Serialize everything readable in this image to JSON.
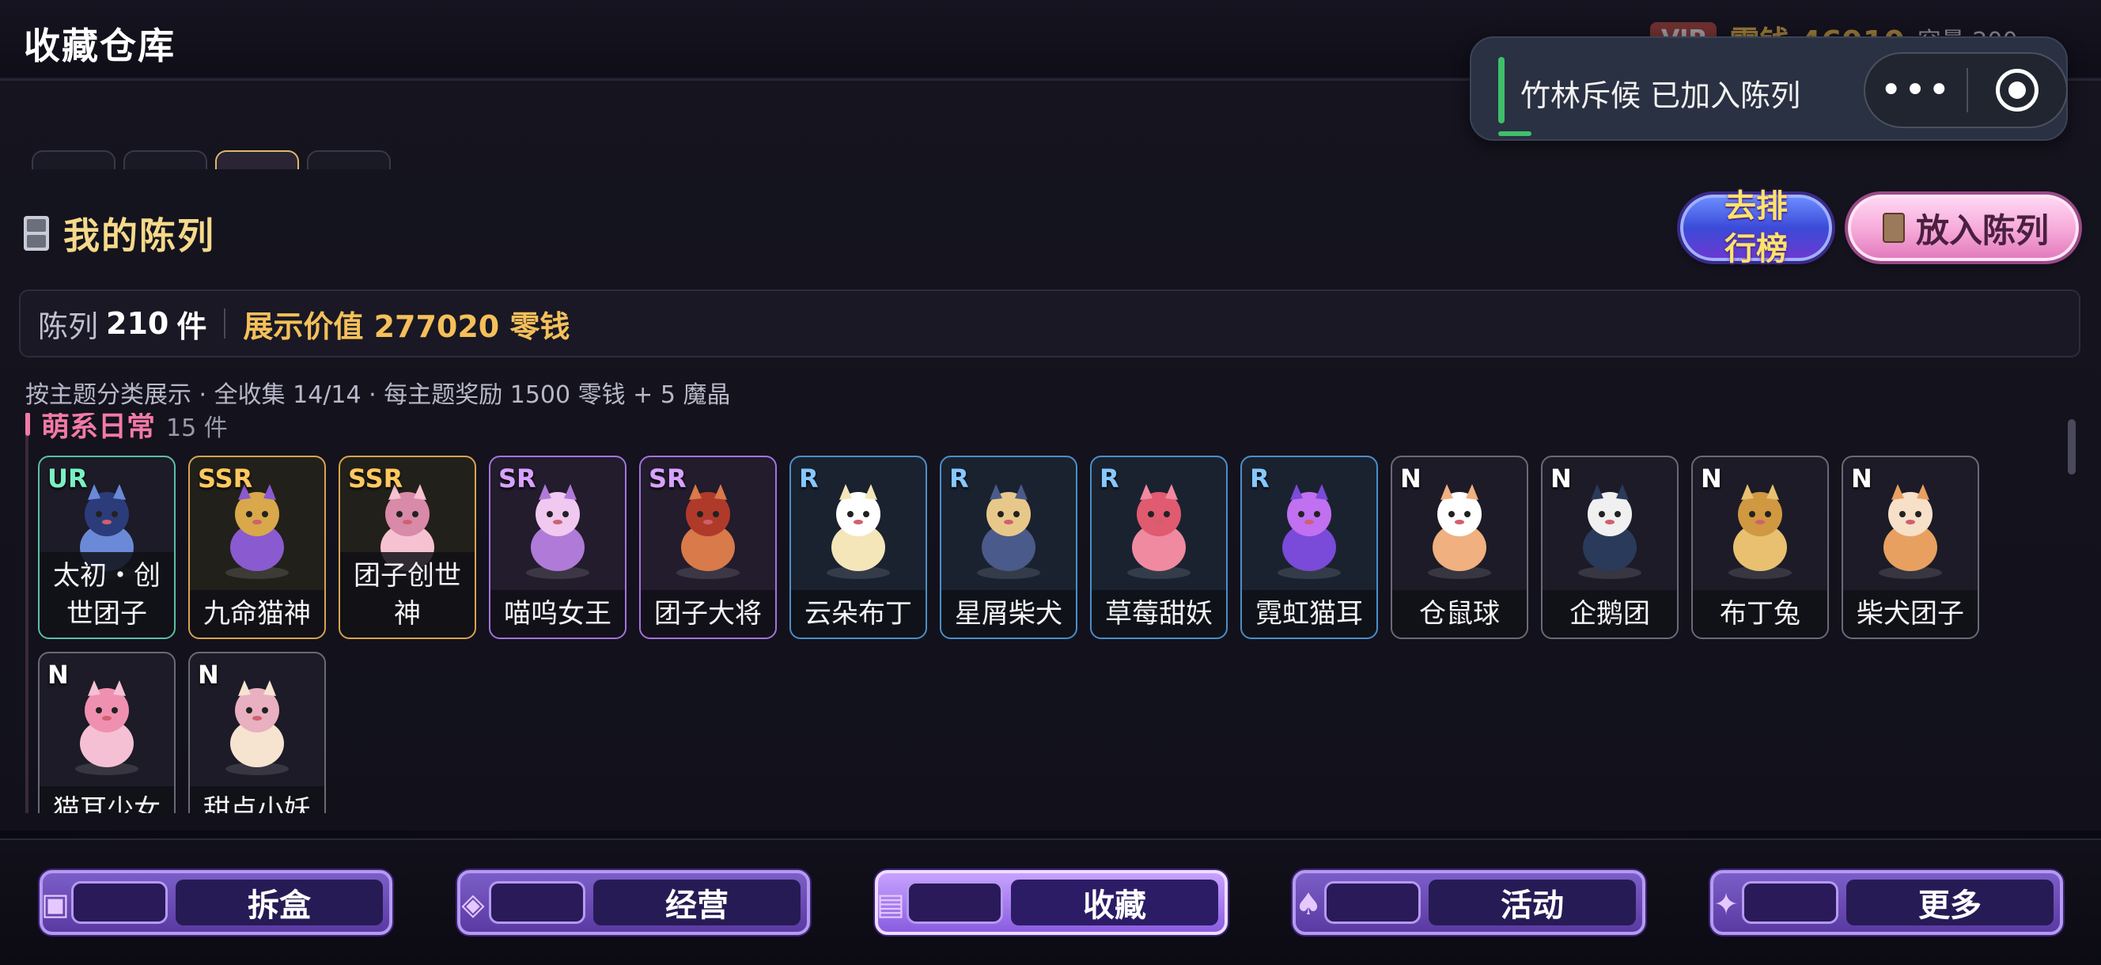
{
  "header": {
    "title": "收藏仓库",
    "currency_badge": "VIP",
    "coin_text": "零钱 46910",
    "capacity_text": "容量 200"
  },
  "toast": {
    "message": "竹林斥候 已加入陈列",
    "more_glyph": "•••",
    "accent_color": "#3fbf6b"
  },
  "section": {
    "title": "我的陈列",
    "rank_button": "去排行榜",
    "display_button": "放入陈列"
  },
  "stats": {
    "count_label": "陈列",
    "count_value": "210",
    "count_unit": "件",
    "value_text": "展示价值 277020 零钱"
  },
  "subtitle": "按主题分类展示 · 全收集 14/14 · 每主题奖励 1500 零钱 + 5 魔晶",
  "group": {
    "name": "萌系日常",
    "count": "15 件"
  },
  "cards": [
    {
      "rarity": "UR",
      "name": "太初・创世团子",
      "art": "blue-frog-icon"
    },
    {
      "rarity": "SSR",
      "name": "九命猫神",
      "art": "purple-lotus-cat-icon"
    },
    {
      "rarity": "SSR",
      "name": "团子创世神",
      "art": "pink-dumpling-icon"
    },
    {
      "rarity": "SR",
      "name": "喵呜女王",
      "art": "cat-queen-icon"
    },
    {
      "rarity": "SR",
      "name": "团子大将",
      "art": "samurai-icon"
    },
    {
      "rarity": "R",
      "name": "云朵布丁",
      "art": "cloud-pudding-icon"
    },
    {
      "rarity": "R",
      "name": "星屑柴犬",
      "art": "star-shiba-icon"
    },
    {
      "rarity": "R",
      "name": "草莓甜妖",
      "art": "strawberry-fairy-icon"
    },
    {
      "rarity": "R",
      "name": "霓虹猫耳",
      "art": "neon-cat-girl-icon"
    },
    {
      "rarity": "N",
      "name": "仓鼠球",
      "art": "hamster-icon"
    },
    {
      "rarity": "N",
      "name": "企鹅团",
      "art": "penguin-icon"
    },
    {
      "rarity": "N",
      "name": "布丁兔",
      "art": "pudding-bunny-icon"
    },
    {
      "rarity": "N",
      "name": "柴犬团子",
      "art": "shiba-icon"
    },
    {
      "rarity": "N",
      "name": "猫耳少女",
      "art": "cat-girl-icon"
    },
    {
      "rarity": "N",
      "name": "甜点小妖",
      "art": "dessert-fairy-icon"
    }
  ],
  "bottom_nav": [
    {
      "label": "拆盒",
      "icon": "box-icon"
    },
    {
      "label": "经营",
      "icon": "bag-icon"
    },
    {
      "label": "收藏",
      "icon": "cabinet-icon",
      "active": true
    },
    {
      "label": "活动",
      "icon": "figure-icon"
    },
    {
      "label": "更多",
      "icon": "star-icon"
    }
  ]
}
